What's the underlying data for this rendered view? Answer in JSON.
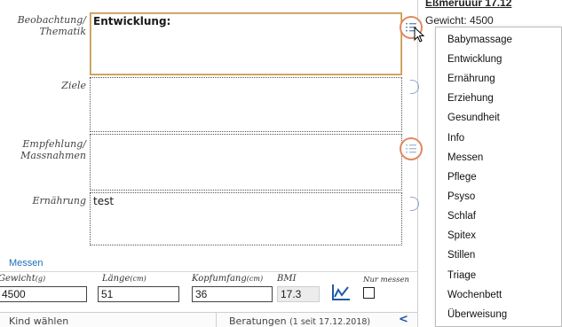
{
  "form": {
    "beobachtung_label_1": "Beobachtung/",
    "beobachtung_label_2": "Thematik",
    "beobachtung_value": "Entwicklung:",
    "ziele_label": "Ziele",
    "ziele_value": "",
    "empfehlung_label_1": "Empfehlung/",
    "empfehlung_label_2": "Massnahmen",
    "empfehlung_value": "",
    "ernaehrung_label": "Ernährung",
    "ernaehrung_value": "test"
  },
  "right_panel": {
    "top_partial": "Eßmeruuur 17.12",
    "gewicht": "Gewicht: 4500"
  },
  "dropdown": {
    "items": [
      "Babymassage",
      "Entwicklung",
      "Ernährung",
      "Erziehung",
      "Gesundheit",
      "Info",
      "Messen",
      "Pflege",
      "Psyso",
      "Schlaf",
      "Spitex",
      "Stillen",
      "Triage",
      "Wochenbett",
      "Überweisung"
    ]
  },
  "messen": {
    "title": "Messen",
    "gewicht_label": "Gewicht",
    "gewicht_unit": "(g)",
    "gewicht_value": "4500",
    "laenge_label": "Länge",
    "laenge_unit": "(cm)",
    "laenge_value": "51",
    "kopf_label": "Kopfumfang",
    "kopf_unit": "(cm)",
    "kopf_value": "36",
    "bmi_label": "BMI",
    "bmi_value": "17.3",
    "nur_messen_label": "Nur messen"
  },
  "bottom": {
    "kind_waehlen": "Kind wählen",
    "beratungen": "Beratungen",
    "beratungen_info": "(1 seit 17.12.2018)",
    "prev_arrow": "<"
  }
}
